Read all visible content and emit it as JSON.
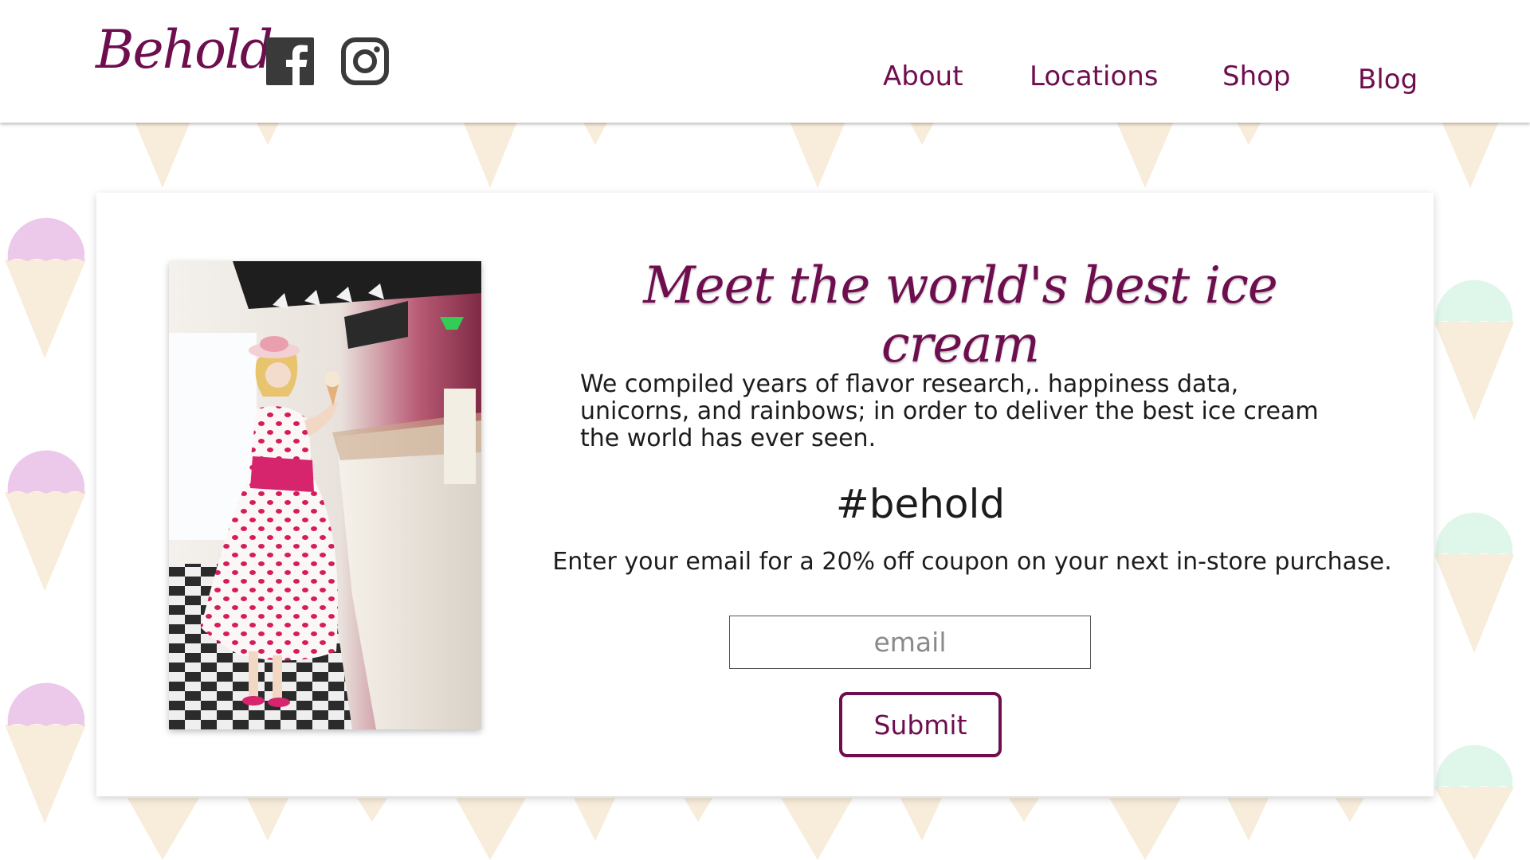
{
  "header": {
    "logo": "Behold",
    "social": [
      {
        "icon": "facebook-icon"
      },
      {
        "icon": "instagram-icon"
      }
    ],
    "nav": [
      {
        "label": "About"
      },
      {
        "label": "Locations"
      },
      {
        "label": "Shop"
      },
      {
        "label": "Blog"
      }
    ]
  },
  "hero": {
    "headline": "Meet the world's best ice cream",
    "description": "We compiled years of flavor research,. happiness data, unicorns, and rainbows; in order to deliver the best ice cream the world has ever seen.",
    "hashtag": "#behold",
    "coupon_text": "Enter your email for a 20% off coupon on your next in-store purchase.",
    "email_placeholder": "email",
    "submit_label": "Submit"
  },
  "colors": {
    "brand": "#6e0e4f",
    "cone": "#f8ecda",
    "scoop_pink": "#ecc8ea",
    "scoop_mint": "#dff7ea"
  }
}
